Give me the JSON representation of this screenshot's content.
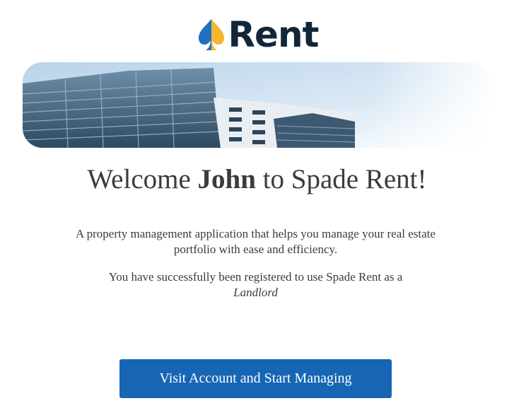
{
  "brand": {
    "name": "Rent",
    "logo_icon": "spade-icon",
    "colors": {
      "spade_blue": "#2e86de",
      "spade_yellow": "#f5b731",
      "text": "#12263a"
    }
  },
  "hero": {
    "image": "office-buildings-photo"
  },
  "welcome": {
    "prefix": "Welcome ",
    "name": "John",
    "suffix": " to Spade Rent!"
  },
  "description": "A property management application that helps you manage your real estate portfolio with ease and efficiency.",
  "registration": {
    "text": "You have successfully been registered to use Spade Rent as a",
    "role": "Landlord"
  },
  "cta": {
    "label": "Visit Account and Start Managing",
    "color": "#1765b5"
  }
}
